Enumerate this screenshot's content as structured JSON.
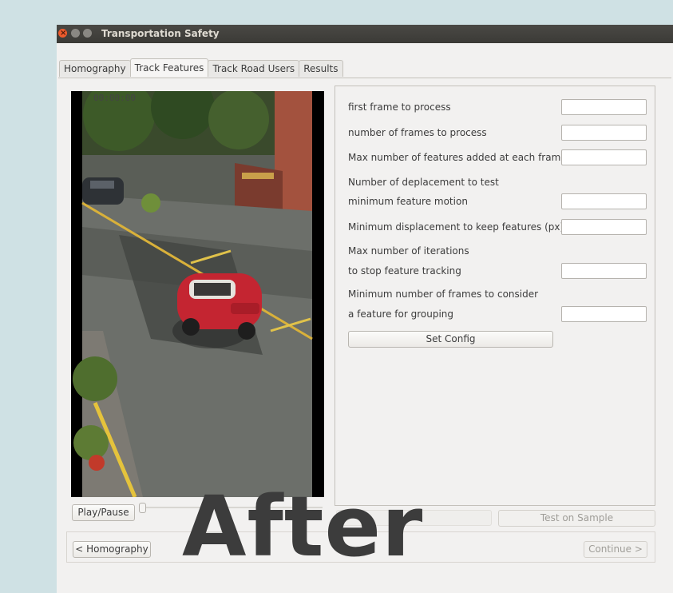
{
  "window": {
    "title": "Transportation Safety"
  },
  "tabs": [
    "Homography",
    "Track Features",
    "Track Road Users",
    "Results"
  ],
  "video": {
    "timestamp": "00:00:00"
  },
  "config": {
    "rows": [
      {
        "label": "first frame to process",
        "has_field": true,
        "value": ""
      },
      {
        "label": "number of frames to process",
        "has_field": true,
        "value": ""
      },
      {
        "label": "Max number of features added at each frame",
        "has_field": true,
        "value": ""
      },
      {
        "label": "Number of deplacement to test",
        "has_field": false
      },
      {
        "label": "minimum feature motion",
        "has_field": true,
        "value": ""
      },
      {
        "label": "Minimum displacement to keep features (px)",
        "has_field": true,
        "value": ""
      },
      {
        "label": "Max number of iterations",
        "has_field": false
      },
      {
        "label": "to stop feature tracking",
        "has_field": true,
        "value": ""
      },
      {
        "label": "Minimum number of frames to consider",
        "has_field": false
      },
      {
        "label": "a feature for grouping",
        "has_field": true,
        "value": ""
      }
    ],
    "set_config_label": "Set Config"
  },
  "controls": {
    "play_pause_label": "Play/Pause",
    "slider_value": 0,
    "progress_text": "0%",
    "progress_value": 0,
    "test_on_sample_label": "Test on Sample"
  },
  "nav": {
    "back_label": "< Homography",
    "continue_label": "Continue >"
  },
  "overlay": {
    "text": "After"
  },
  "colors": {
    "desktop": "#cfe1e4",
    "titlebar": "#3c3b37",
    "close_button": "#ee5b2d",
    "car": "#c42531"
  }
}
